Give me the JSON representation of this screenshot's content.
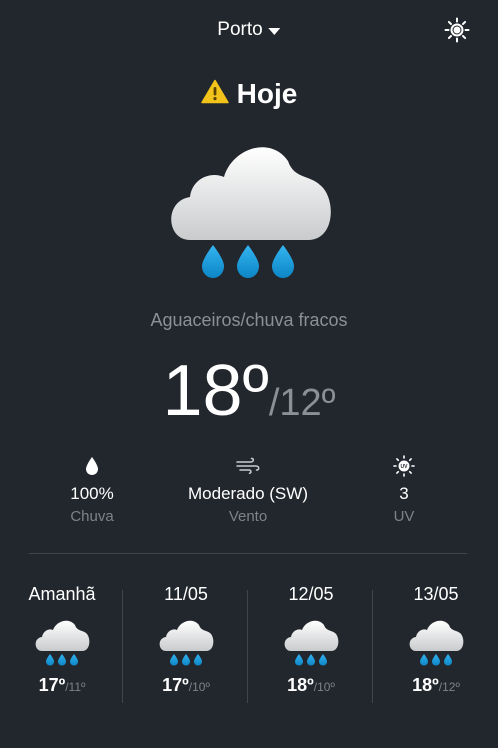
{
  "header": {
    "city": "Porto",
    "theme_icon": "sun-icon"
  },
  "today": {
    "title": "Hoje",
    "alert_icon": "warning-icon",
    "weather_icon": "rain-cloud-icon",
    "description": "Aguaceiros/chuva fracos",
    "temp_max": "18º",
    "temp_min": "/12º"
  },
  "stats": {
    "rain": {
      "value": "100%",
      "label": "Chuva",
      "icon": "droplet-icon"
    },
    "wind": {
      "value": "Moderado (SW)",
      "label": "Vento",
      "icon": "wind-icon"
    },
    "uv": {
      "value": "3",
      "label": "UV",
      "icon": "uv-icon"
    }
  },
  "forecast": [
    {
      "date": "Amanhã",
      "max": "17º",
      "min": "/11º",
      "icon": "rain-cloud-icon"
    },
    {
      "date": "11/05",
      "max": "17º",
      "min": "/10º",
      "icon": "rain-cloud-icon"
    },
    {
      "date": "12/05",
      "max": "18º",
      "min": "/10º",
      "icon": "rain-cloud-icon"
    },
    {
      "date": "13/05",
      "max": "18º",
      "min": "/12º",
      "icon": "rain-cloud-icon"
    }
  ],
  "colors": {
    "background": "#22272d",
    "accent_rain": "#1a9ee0",
    "warning": "#f2c31b",
    "muted_text": "#8a9096"
  }
}
